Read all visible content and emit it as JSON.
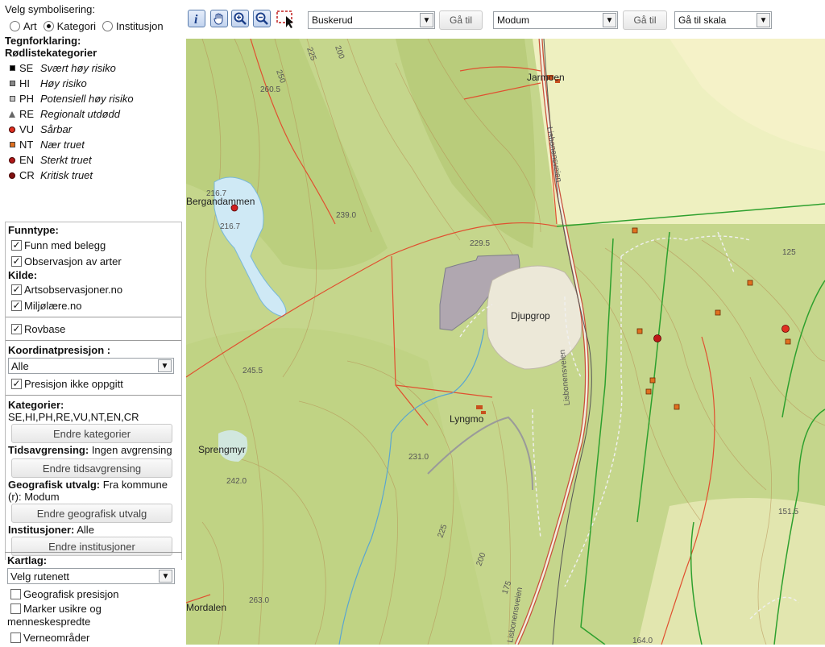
{
  "sidebar": {
    "symbolisering_label": "Velg symbolisering:",
    "symbolisering_options": [
      "Art",
      "Kategori",
      "Institusjon"
    ],
    "tegnforklaring_label": "Tegnforklaring:",
    "rodliste_label": "Rødlistekategorier",
    "legend": [
      {
        "code": "SE",
        "name": "Svært høy risiko",
        "symbol": "square",
        "color": "#000000"
      },
      {
        "code": "HI",
        "name": "Høy risiko",
        "symbol": "square",
        "color": "#888888"
      },
      {
        "code": "PH",
        "name": "Potensiell høy risiko",
        "symbol": "square",
        "color": "#c8c8c8"
      },
      {
        "code": "RE",
        "name": "Regionalt utdødd",
        "symbol": "triangle",
        "color": "#666666"
      },
      {
        "code": "VU",
        "name": "Sårbar",
        "symbol": "dot",
        "color": "#e03020"
      },
      {
        "code": "NT",
        "name": "Nær truet",
        "symbol": "square",
        "color": "#e07020"
      },
      {
        "code": "EN",
        "name": "Sterkt truet",
        "symbol": "dot",
        "color": "#b01818"
      },
      {
        "code": "CR",
        "name": "Kritisk truet",
        "symbol": "dot",
        "color": "#801010"
      }
    ]
  },
  "filter": {
    "funntype_label": "Funntype:",
    "funn_med_belegg": "Funn med belegg",
    "observasjon_av_arter": "Observasjon av arter",
    "kilde_label": "Kilde:",
    "artsobservasjoner": "Artsobservasjoner.no",
    "miljolare": "Miljølære.no",
    "rovbase": "Rovbase",
    "koordinatpresisjon_label": "Koordinatpresisjon :",
    "koordinatpresisjon_value": "Alle",
    "presisjon_ikke_oppgitt": "Presisjon ikke oppgitt",
    "kategorier_label": "Kategorier:",
    "kategorier_value": "SE,HI,PH,RE,VU,NT,EN,CR",
    "endre_kategorier": "Endre kategorier",
    "tidsavgrensing_label": "Tidsavgrensing:",
    "tidsavgrensing_value": "Ingen avgrensing",
    "endre_tidsavgrensing": "Endre tidsavgrensing",
    "geografisk_label": "Geografisk utvalg:",
    "geografisk_value": "Fra kommune",
    "geografisk_value2": "(r): Modum",
    "endre_geografisk": "Endre geografisk utvalg",
    "institusjoner_label": "Institusjoner:",
    "institusjoner_value": "Alle",
    "endre_institusjoner": "Endre institusjoner"
  },
  "kartlag": {
    "label": "Kartlag:",
    "rutenett_value": "Velg rutenett",
    "geografisk_presisjon": "Geografisk presisjon",
    "marker_usikre_line1": "Marker usikre og",
    "marker_usikre_line2": "menneskespredte",
    "verneomrader": "Verneområder"
  },
  "toolbar": {
    "fylke_value": "Buskerud",
    "ga_til_1": "Gå til",
    "kommune_value": "Modum",
    "ga_til_2": "Gå til",
    "skala_value": "Gå til skala"
  },
  "map": {
    "places": [
      "Jarmoen",
      "Bergandammen",
      "Djupgrop",
      "Lyngmo",
      "Sprengmyr",
      "Lisbonensveien",
      "Lisbonensveien",
      "Lisbonensveien",
      "Mordalen"
    ],
    "contour_labels": [
      "250",
      "225",
      "200",
      "260.5",
      "216.7",
      "216.7",
      "239.0",
      "229.5",
      "245.5",
      "231.0",
      "242.0",
      "225",
      "200",
      "175",
      "263.0",
      "125",
      "151.5",
      "164.0"
    ]
  },
  "colors": {
    "map_base": "#c9d98f",
    "road_red": "#e05030",
    "boundary_green": "#2ea02e",
    "water": "#cfe9f5"
  }
}
